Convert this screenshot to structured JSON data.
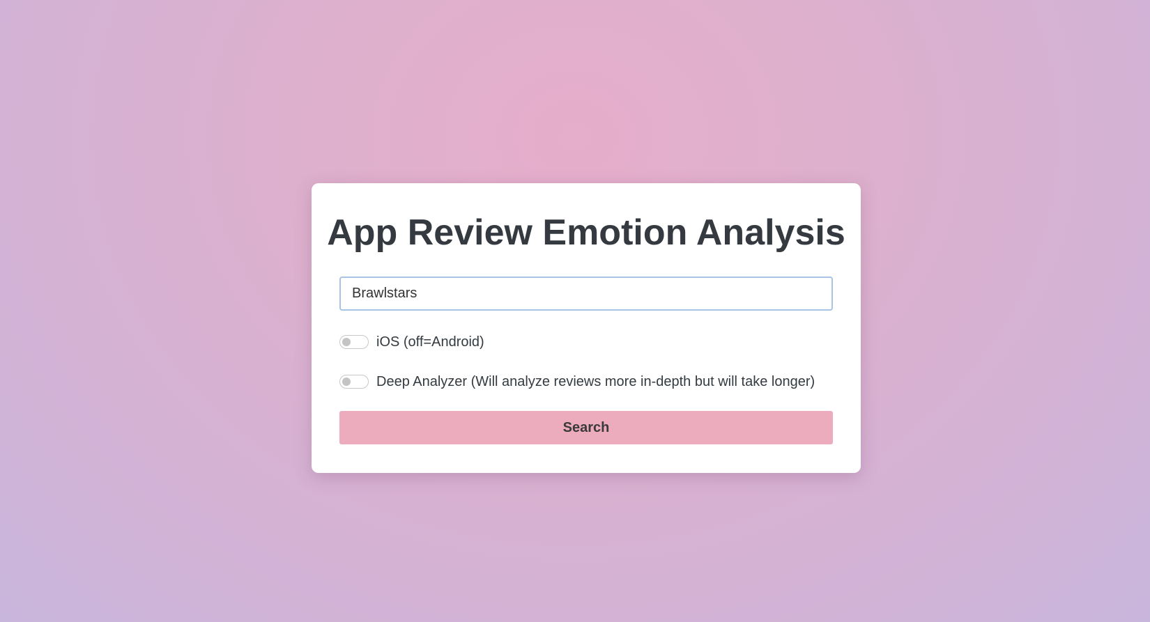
{
  "page": {
    "title": "App Review Emotion Analysis"
  },
  "search": {
    "value": "Brawlstars",
    "placeholder": ""
  },
  "toggles": [
    {
      "label": "iOS (off=Android)",
      "checked": false
    },
    {
      "label": "Deep Analyzer (Will analyze reviews more in-depth but will take longer)",
      "checked": false
    }
  ],
  "search_button": {
    "label": "Search"
  },
  "colors": {
    "button_background": "#edabbe",
    "title_color": "#343a40",
    "input_border": "#a7c3e6",
    "background_center": "#e5aecb",
    "background_edge": "#c9b6dc"
  }
}
